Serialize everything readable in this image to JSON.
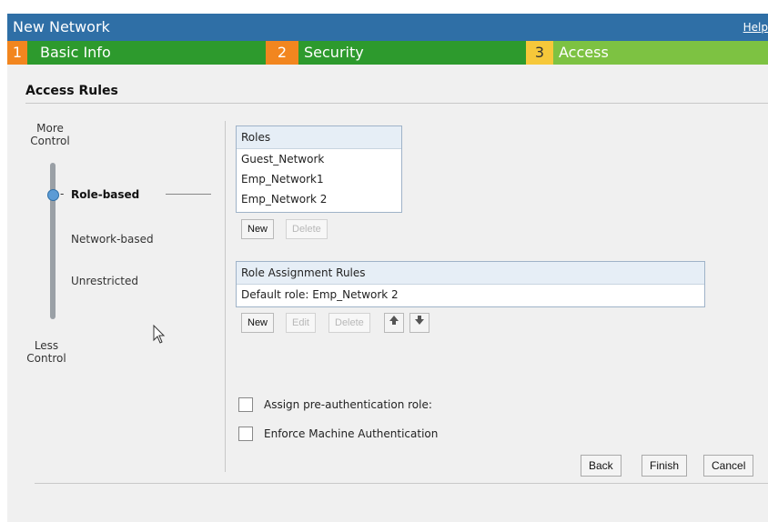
{
  "window": {
    "title": "New Network",
    "help_link": "Help"
  },
  "steps": [
    {
      "num": "1",
      "label": "Basic Info"
    },
    {
      "num": "2",
      "label": "Security"
    },
    {
      "num": "3",
      "label": "Access"
    }
  ],
  "section": {
    "title": "Access Rules"
  },
  "slider": {
    "top_label_1": "More",
    "top_label_2": "Control",
    "bottom_label_1": "Less",
    "bottom_label_2": "Control",
    "options": [
      "Role-based",
      "Network-based",
      "Unrestricted"
    ],
    "selected": "Role-based"
  },
  "roles": {
    "header": "Roles",
    "items": [
      "Guest_Network",
      "Emp_Network1",
      "Emp_Network 2"
    ],
    "new_label": "New",
    "delete_label": "Delete"
  },
  "role_assignment": {
    "header": "Role Assignment Rules",
    "items": [
      "Default role: Emp_Network 2"
    ],
    "new_label": "New",
    "edit_label": "Edit",
    "delete_label": "Delete",
    "up_icon": "arrow-up-icon",
    "down_icon": "arrow-down-icon"
  },
  "options": {
    "preauth_label": "Assign pre-authentication role:",
    "preauth_checked": false,
    "machine_auth_label": "Enforce Machine Authentication",
    "machine_auth_checked": false
  },
  "footer": {
    "back_label": "Back",
    "finish_label": "Finish",
    "cancel_label": "Cancel"
  }
}
